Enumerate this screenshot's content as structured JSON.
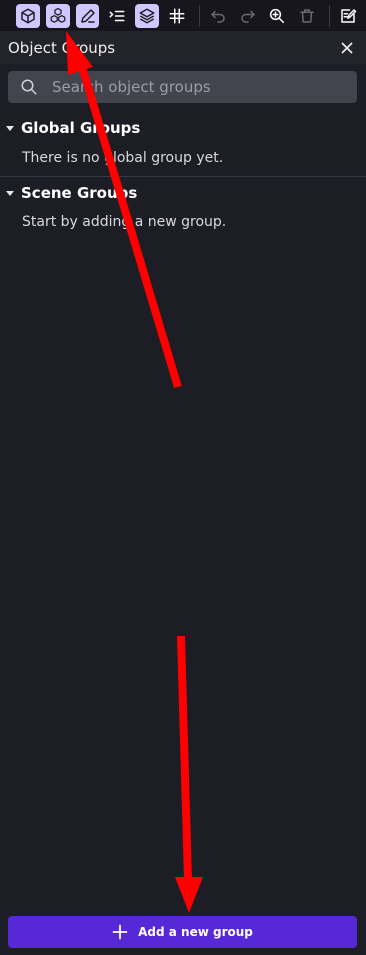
{
  "toolbar": {
    "buttons": [
      {
        "name": "object-icon",
        "active": true
      },
      {
        "name": "object-groups-icon",
        "active": true
      },
      {
        "name": "edit-pencil-icon",
        "active": true
      },
      {
        "name": "list-icon",
        "active": false
      },
      {
        "name": "layers-icon",
        "active": true
      },
      {
        "name": "grid-icon",
        "active": false
      },
      {
        "name": "undo-icon",
        "active": false
      },
      {
        "name": "redo-icon",
        "active": false
      },
      {
        "name": "zoom-icon",
        "active": false
      },
      {
        "name": "trash-icon",
        "active": false
      },
      {
        "name": "edit-properties-icon",
        "active": false
      }
    ]
  },
  "panel": {
    "title": "Object Groups",
    "close_icon": "close-icon"
  },
  "search": {
    "placeholder": "Search object groups",
    "value": ""
  },
  "groups": [
    {
      "title": "Global Groups",
      "empty_text": "There is no global group yet."
    },
    {
      "title": "Scene Groups",
      "empty_text": "Start by adding a new group."
    }
  ],
  "footer": {
    "add_label": "Add a new group"
  },
  "colors": {
    "accent": "#5728d6",
    "active_tool": "#d2c6ff",
    "annotation_arrow": "#ff0000"
  }
}
